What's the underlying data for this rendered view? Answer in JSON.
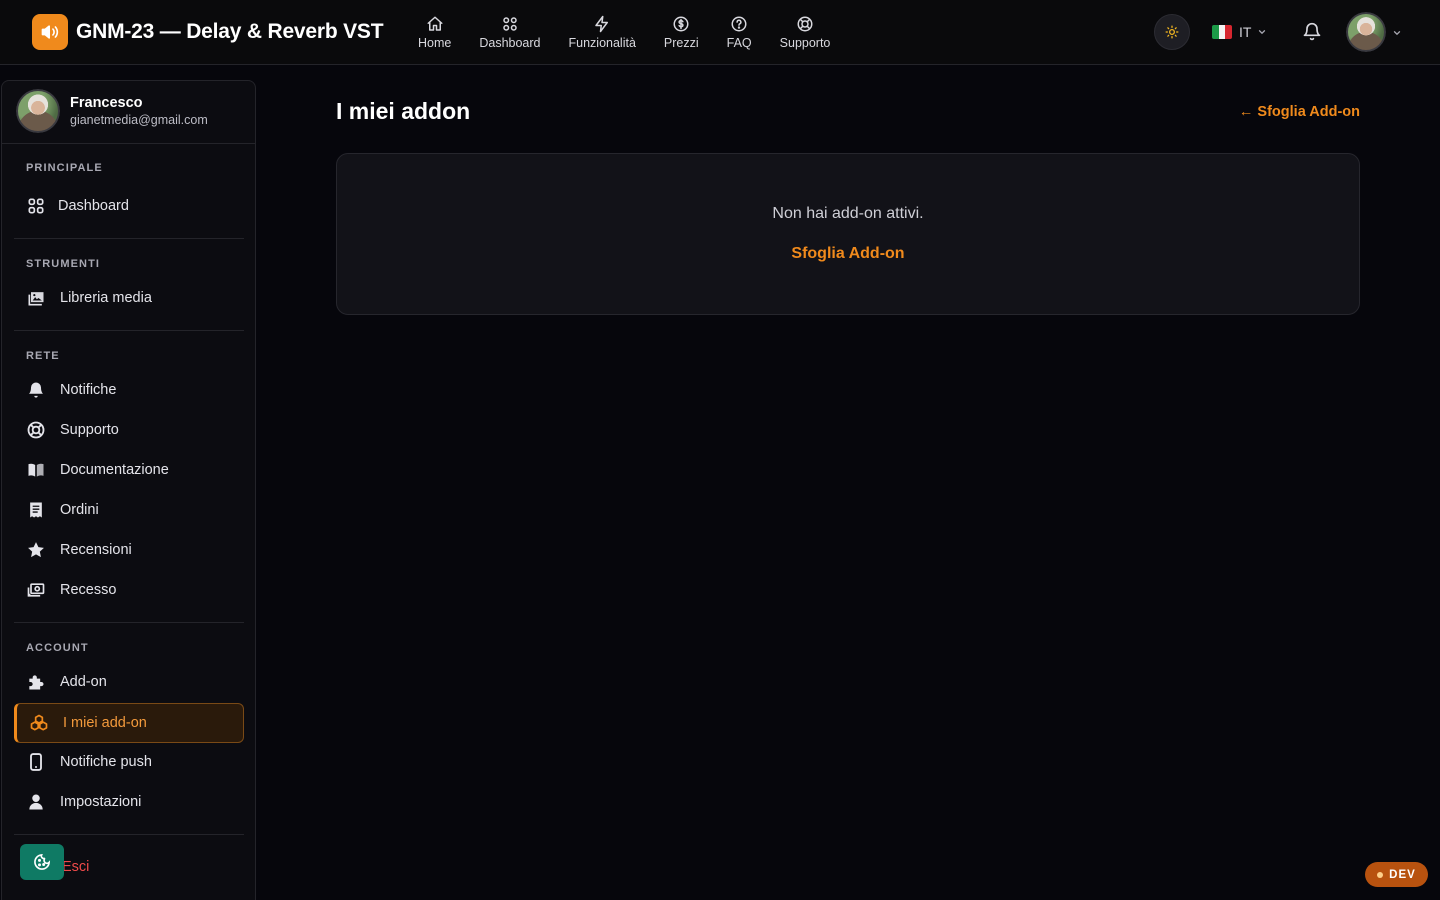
{
  "app": {
    "title": "GNM-23 — Delay & Reverb VST",
    "logo_icon": "speaker-icon",
    "accent_color": "#f08a1c"
  },
  "topnav": {
    "items": [
      {
        "label": "Home",
        "icon": "home-icon"
      },
      {
        "label": "Dashboard",
        "icon": "grid-icon"
      },
      {
        "label": "Funzionalità",
        "icon": "lightning-icon"
      },
      {
        "label": "Prezzi",
        "icon": "dollar-icon"
      },
      {
        "label": "FAQ",
        "icon": "help-icon"
      },
      {
        "label": "Supporto",
        "icon": "lifebuoy-icon"
      }
    ],
    "language": "IT",
    "theme_icon": "sun-icon",
    "notification_icon": "bell-icon"
  },
  "sidebar": {
    "user": {
      "name": "Francesco",
      "email": "gianetmedia@gmail.com"
    },
    "sections": [
      {
        "title": "PRINCIPALE",
        "items": [
          {
            "label": "Dashboard",
            "icon": "grid-icon"
          }
        ]
      },
      {
        "title": "STRUMENTI",
        "items": [
          {
            "label": "Libreria media",
            "icon": "photos-icon"
          }
        ]
      },
      {
        "title": "RETE",
        "items": [
          {
            "label": "Notifiche",
            "icon": "bell-icon"
          },
          {
            "label": "Supporto",
            "icon": "lifebuoy-icon"
          },
          {
            "label": "Documentazione",
            "icon": "book-icon"
          },
          {
            "label": "Ordini",
            "icon": "receipt-icon"
          },
          {
            "label": "Recensioni",
            "icon": "star-icon"
          },
          {
            "label": "Recesso",
            "icon": "money-refund-icon"
          }
        ]
      },
      {
        "title": "ACCOUNT",
        "items": [
          {
            "label": "Add-on",
            "icon": "puzzle-icon"
          },
          {
            "label": "I miei add-on",
            "icon": "cubes-icon",
            "active": true
          },
          {
            "label": "Notifiche push",
            "icon": "phone-icon"
          },
          {
            "label": "Impostazioni",
            "icon": "user-icon"
          }
        ]
      }
    ],
    "logout": "Esci",
    "cookie_icon": "cookie-icon"
  },
  "main": {
    "title": "I miei addon",
    "browse_link": "← Sfoglia Add-on",
    "empty_text": "Non hai add-on attivi.",
    "empty_link": "Sfoglia Add-on"
  },
  "badge": {
    "label": "DEV"
  }
}
